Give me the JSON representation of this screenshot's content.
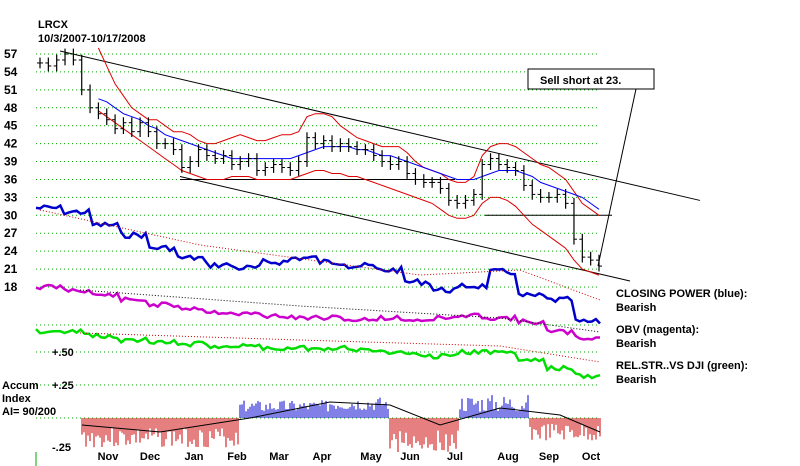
{
  "chart_data": {
    "type": "line",
    "title": "LRCX",
    "subtitle": "10/3/2007-10/17/2008",
    "price_y_ticks": [
      57,
      54,
      51,
      48,
      45,
      42,
      39,
      36,
      33,
      30,
      27,
      24,
      21,
      18
    ],
    "x_months": [
      "Nov",
      "Dec",
      "Jan",
      "Feb",
      "Mar",
      "Apr",
      "May",
      "Jun",
      "Jul",
      "Aug",
      "Sep",
      "Oct"
    ],
    "annotation": "Sell short at 23.",
    "price_close": [
      55.5,
      55,
      56,
      57,
      56,
      51,
      48,
      47,
      46,
      44.5,
      45.5,
      44,
      45.5,
      44,
      42,
      42,
      41,
      38,
      39,
      41,
      40,
      39.5,
      40,
      38.5,
      39,
      39.5,
      37.5,
      38,
      38.5,
      38,
      37.5,
      39,
      43,
      42,
      42.5,
      41.5,
      42,
      41.5,
      41,
      41,
      40,
      39,
      38.5,
      39,
      37,
      36,
      35.5,
      35.5,
      34.5,
      32.5,
      32,
      32.5,
      33.5,
      38.5,
      39.5,
      38.5,
      38,
      37.5,
      35,
      33.5,
      33,
      33,
      33.5,
      32,
      26,
      23,
      22.5,
      21.5
    ],
    "upper_band": [
      null,
      null,
      null,
      null,
      null,
      null,
      null,
      58,
      55,
      52,
      50,
      48,
      47,
      46,
      46,
      45,
      44,
      44,
      43.5,
      42.5,
      42,
      42,
      42.5,
      43,
      43.5,
      43,
      42.5,
      42.5,
      43,
      43.5,
      43.5,
      44,
      46.5,
      47,
      47,
      46.5,
      45,
      44,
      43,
      42.5,
      42,
      41.5,
      41.5,
      41.5,
      40.5,
      39,
      38,
      37.5,
      37,
      36,
      35.5,
      35.5,
      36.5,
      40,
      41.5,
      42,
      42,
      41.5,
      40.5,
      39.5,
      38.5,
      38,
      37,
      36,
      34,
      32,
      31,
      30
    ],
    "lower_band": [
      null,
      null,
      null,
      null,
      null,
      null,
      null,
      47.5,
      46.5,
      45.5,
      44.5,
      43.5,
      42.5,
      41.5,
      40.5,
      39.5,
      38.5,
      37.5,
      37,
      36.5,
      36,
      36,
      36,
      36.5,
      36.5,
      36.5,
      36,
      36,
      36,
      36,
      36,
      36.5,
      37,
      37.5,
      37.5,
      37,
      37,
      36.5,
      36.5,
      36,
      35.5,
      35,
      34.5,
      34,
      33.5,
      33,
      32.5,
      32,
      31,
      30,
      29.5,
      29.5,
      30,
      32,
      33,
      33,
      32.5,
      31.5,
      30,
      28.5,
      27.5,
      26.5,
      25.5,
      24.5,
      22.5,
      21,
      20.5,
      20
    ],
    "ma_blue": [
      null,
      null,
      null,
      null,
      null,
      null,
      null,
      49.5,
      49,
      48,
      47,
      46.5,
      46,
      45,
      44.5,
      43.5,
      43,
      42.5,
      42,
      41.5,
      41,
      40.5,
      40,
      39.5,
      39.5,
      39.5,
      39.5,
      39.5,
      39.5,
      39.5,
      39.5,
      40,
      40.5,
      41,
      41.5,
      41.5,
      41.5,
      41.5,
      41,
      41,
      40.5,
      40,
      40,
      39.5,
      39,
      38.5,
      38,
      37.5,
      37,
      36.5,
      36,
      36,
      36,
      36.5,
      37,
      37.5,
      37.5,
      37.5,
      37,
      36.5,
      35.5,
      35,
      34.5,
      34,
      33.5,
      33,
      32,
      31
    ],
    "sloped_upper_line": [
      [
        57.5,
        0
      ],
      [
        35.5,
        88
      ]
    ],
    "sloped_lower_line": [
      [
        36.5,
        23
      ],
      [
        19,
        96
      ]
    ],
    "support_level_36": 36,
    "support_level_30": 30,
    "closing_power": {
      "label": "CLOSING POWER (blue):",
      "status": "Bearish",
      "color": "#0000cc"
    },
    "obv": {
      "label": "OBV (magenta):",
      "status": "Bearish",
      "color": "#cc00cc"
    },
    "rel_str": {
      "label": "REL.STR..VS DJI (green):",
      "status": "Bearish",
      "color": "#00dd00"
    },
    "rel_str_ticks": [
      "+.50",
      "+.25",
      "-.25"
    ],
    "accum": {
      "line1": "Accum",
      "line2": "Index",
      "line3": "AI= 90/200"
    },
    "colors": {
      "price_band": "#dd0000",
      "ma": "#0000ff",
      "grid": "#00aa00"
    }
  }
}
